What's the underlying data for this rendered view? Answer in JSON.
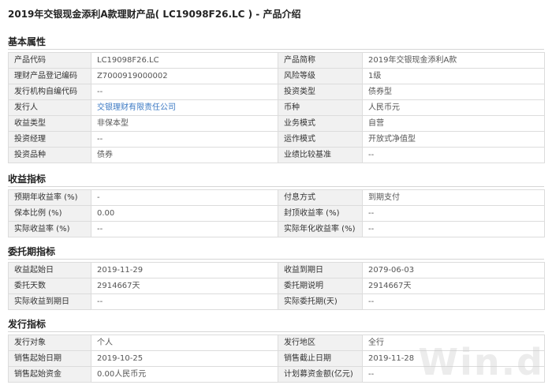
{
  "title": "2019年交银现金添利A款理财产品( LC19098F26.LC ) - 产品介绍",
  "watermark": "Win.d",
  "colors": {
    "link": "#3a78c3",
    "label_bg": "#f1f1f1",
    "border": "#dcdcdc"
  },
  "sections": [
    {
      "title": "基本属性",
      "rows": [
        [
          "产品代码",
          "LC19098F26.LC",
          "产品简称",
          "2019年交银现金添利A款"
        ],
        [
          "理财产品登记编码",
          "Z7000919000002",
          "风险等级",
          "1级"
        ],
        [
          "发行机构自编代码",
          "--",
          "投资类型",
          "债券型"
        ],
        [
          "发行人",
          "交银理财有限责任公司",
          "币种",
          "人民币元"
        ],
        [
          "收益类型",
          "非保本型",
          "业务模式",
          "自营"
        ],
        [
          "投资经理",
          "--",
          "运作模式",
          "开放式净值型"
        ],
        [
          "投资品种",
          "债券",
          "业绩比较基准",
          "--"
        ]
      ]
    },
    {
      "title": "收益指标",
      "rows": [
        [
          "预期年收益率 (%)",
          "-",
          "付息方式",
          "到期支付"
        ],
        [
          "保本比例 (%)",
          "0.00",
          "封顶收益率 (%)",
          "--"
        ],
        [
          "实际收益率 (%)",
          "--",
          "实际年化收益率 (%)",
          "--"
        ]
      ]
    },
    {
      "title": "委托期指标",
      "rows": [
        [
          "收益起始日",
          "2019-11-29",
          "收益到期日",
          "2079-06-03"
        ],
        [
          "委托天数",
          "2914667天",
          "委托期说明",
          "2914667天"
        ],
        [
          "实际收益到期日",
          "--",
          "实际委托期(天)",
          "--"
        ]
      ]
    },
    {
      "title": "发行指标",
      "rows": [
        [
          "发行对象",
          "个人",
          "发行地区",
          "全行"
        ],
        [
          "销售起始日期",
          "2019-10-25",
          "销售截止日期",
          "2019-11-28"
        ],
        [
          "销售起始资金",
          "0.00人民币元",
          "计划募资金额(亿元)",
          "--"
        ]
      ]
    }
  ]
}
